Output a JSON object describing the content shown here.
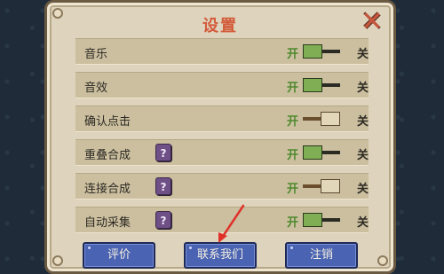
{
  "dialog": {
    "title": "设置",
    "close_label": "✕"
  },
  "settings": [
    {
      "label": "音乐",
      "on_text": "开",
      "off_text": "关",
      "state": "on",
      "has_help": false
    },
    {
      "label": "音效",
      "on_text": "开",
      "off_text": "关",
      "state": "on",
      "has_help": false
    },
    {
      "label": "确认点击",
      "on_text": "开",
      "off_text": "关",
      "state": "off",
      "has_help": false
    },
    {
      "label": "重叠合成",
      "on_text": "开",
      "off_text": "关",
      "state": "on",
      "has_help": true,
      "help_text": "?"
    },
    {
      "label": "连接合成",
      "on_text": "开",
      "off_text": "关",
      "state": "off",
      "has_help": true,
      "help_text": "?"
    },
    {
      "label": "自动采集",
      "on_text": "开",
      "off_text": "关",
      "state": "on",
      "has_help": true,
      "help_text": "?"
    }
  ],
  "buttons": {
    "rate": "评价",
    "contact": "联系我们",
    "logout": "注销"
  },
  "colors": {
    "title": "#d35a3a",
    "on_label": "#4f8a2e",
    "button_bg": "#4a63b3",
    "toggle_on": "#7fae54",
    "annotation_arrow": "#e0302a"
  }
}
